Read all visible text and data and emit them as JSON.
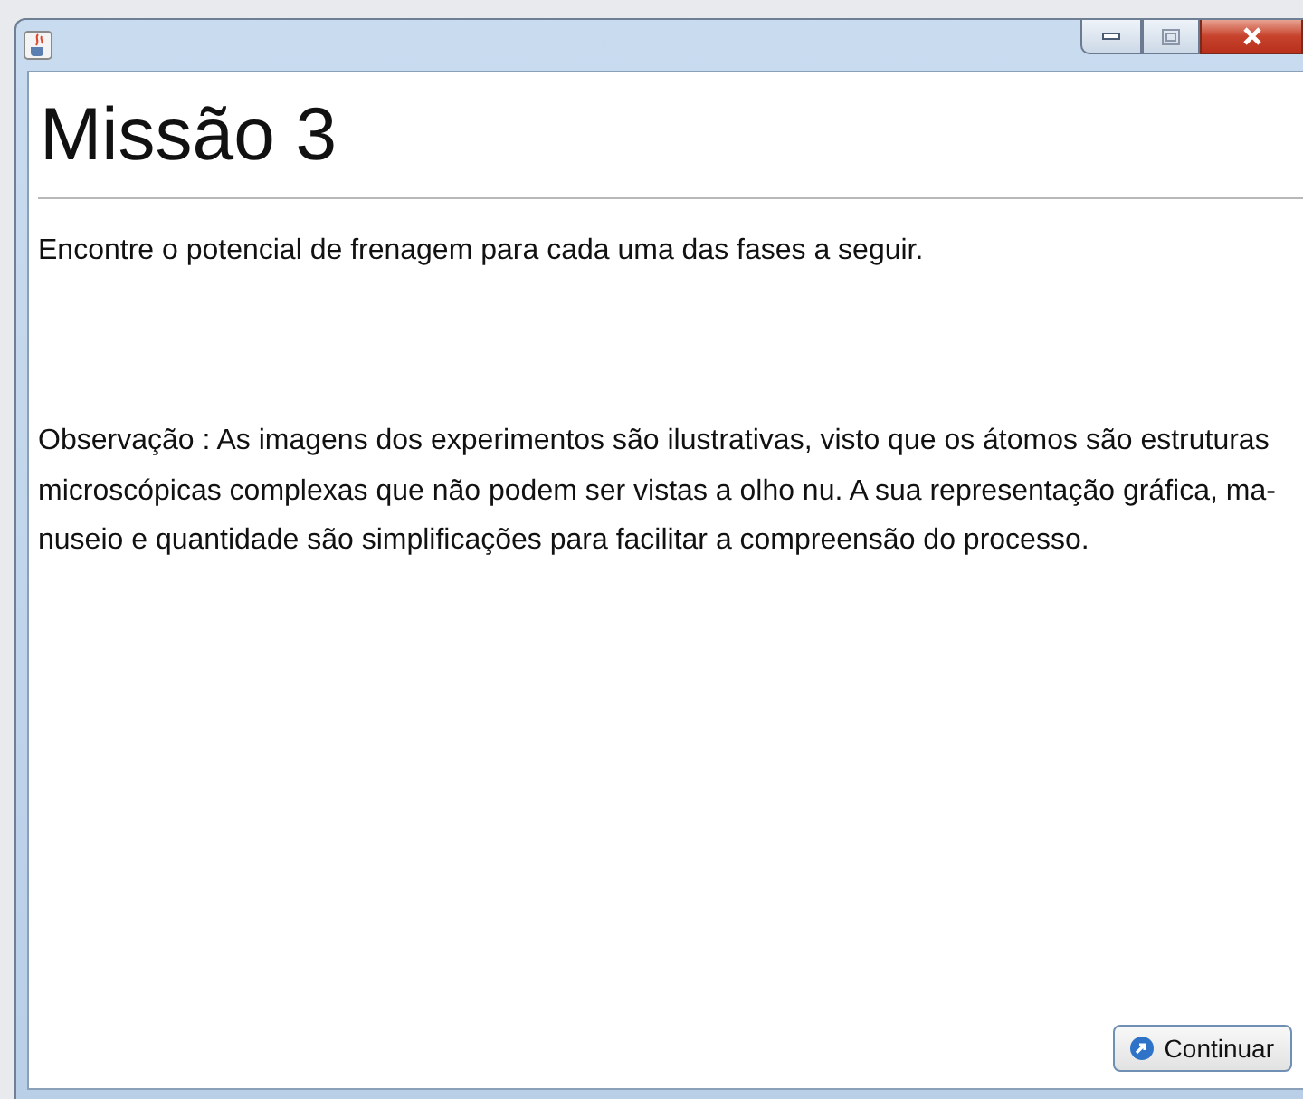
{
  "window": {
    "controls": [
      {
        "kind": "minimize"
      },
      {
        "kind": "maximize"
      },
      {
        "kind": "close"
      }
    ]
  },
  "heading": "Missão 3",
  "instruction": "Encontre o potencial de frenagem para cada uma das fases a seguir.",
  "note_lines": [
    "Observação : As imagens dos experimentos são ilustrativas, visto que os átomos são estruturas",
    "microscópicas complexas que não podem ser vistas a olho nu. A sua representação gráfica, ma-",
    "nuseio e quantidade são simplificações para facilitar a compreensão do processo."
  ],
  "buttons": [
    {
      "label": "Continuar"
    }
  ]
}
